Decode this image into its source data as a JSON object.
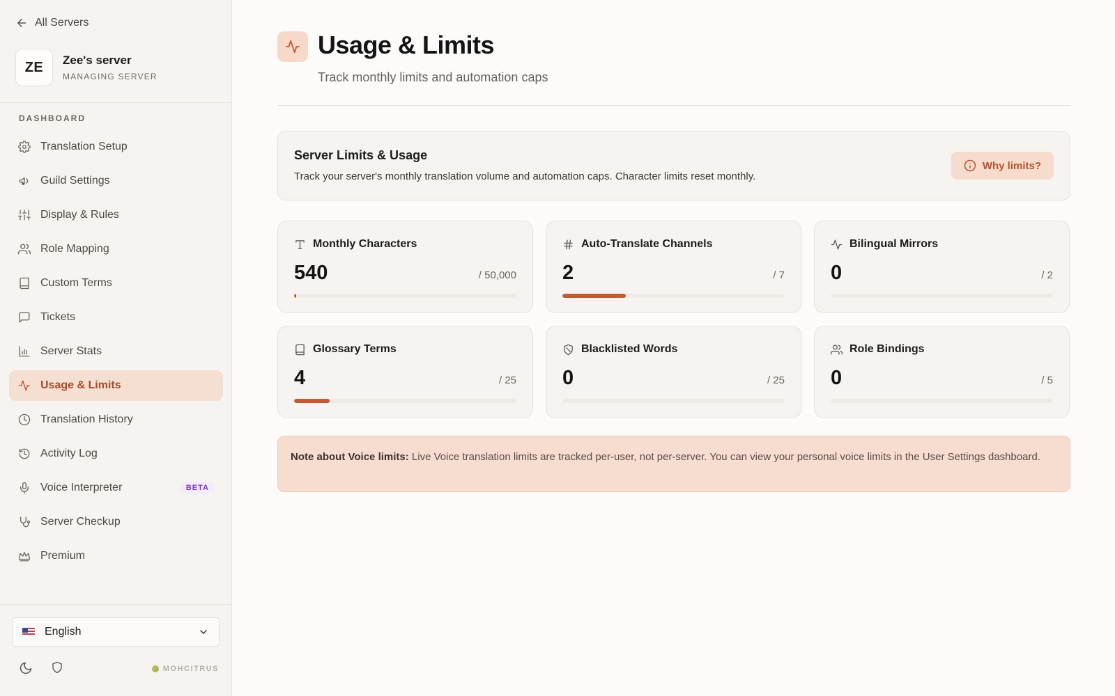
{
  "sidebar": {
    "back_label": "All Servers",
    "server_initials": "ZE",
    "server_name": "Zee's server",
    "server_role": "MANAGING SERVER",
    "section_label": "DASHBOARD",
    "items": [
      {
        "label": "Translation Setup",
        "icon": "gear-icon"
      },
      {
        "label": "Guild Settings",
        "icon": "megaphone-icon"
      },
      {
        "label": "Display & Rules",
        "icon": "sliders-icon"
      },
      {
        "label": "Role Mapping",
        "icon": "users-icon"
      },
      {
        "label": "Custom Terms",
        "icon": "book-icon"
      },
      {
        "label": "Tickets",
        "icon": "chat-icon"
      },
      {
        "label": "Server Stats",
        "icon": "bar-chart-icon"
      },
      {
        "label": "Usage & Limits",
        "icon": "activity-icon",
        "active": true
      },
      {
        "label": "Translation History",
        "icon": "clock-icon"
      },
      {
        "label": "Activity Log",
        "icon": "history-icon"
      },
      {
        "label": "Voice Interpreter",
        "icon": "mic-icon",
        "badge": "BETA"
      },
      {
        "label": "Server Checkup",
        "icon": "stethoscope-icon"
      },
      {
        "label": "Premium",
        "icon": "crown-icon"
      }
    ],
    "language": "English",
    "brand": "MOHCITRUS"
  },
  "page": {
    "title": "Usage & Limits",
    "subtitle": "Track monthly limits and automation caps"
  },
  "info": {
    "title": "Server Limits & Usage",
    "text": "Track your server's monthly translation volume and automation caps. Character limits reset monthly.",
    "button_label": "Why limits?"
  },
  "stats": [
    {
      "label": "Monthly Characters",
      "value": "540",
      "limit": "/ 50,000",
      "fraction": 0.0108,
      "icon": "text-icon"
    },
    {
      "label": "Auto-Translate Channels",
      "value": "2",
      "limit": "/ 7",
      "fraction": 0.2857,
      "icon": "hash-icon"
    },
    {
      "label": "Bilingual Mirrors",
      "value": "0",
      "limit": "/ 2",
      "fraction": 0,
      "icon": "activity-icon"
    },
    {
      "label": "Glossary Terms",
      "value": "4",
      "limit": "/ 25",
      "fraction": 0.16,
      "icon": "book-icon"
    },
    {
      "label": "Blacklisted Words",
      "value": "0",
      "limit": "/ 25",
      "fraction": 0,
      "icon": "shield-off-icon"
    },
    {
      "label": "Role Bindings",
      "value": "0",
      "limit": "/ 5",
      "fraction": 0,
      "icon": "users-icon"
    }
  ],
  "note": {
    "bold": "Note about Voice limits:",
    "text": " Live Voice translation limits are tracked per-user, not per-server. You can view your personal voice limits in the User Settings dashboard."
  },
  "colors": {
    "accent": "#c45a33",
    "active_bg": "#f5dfd2",
    "beta": "#7b35c4"
  }
}
